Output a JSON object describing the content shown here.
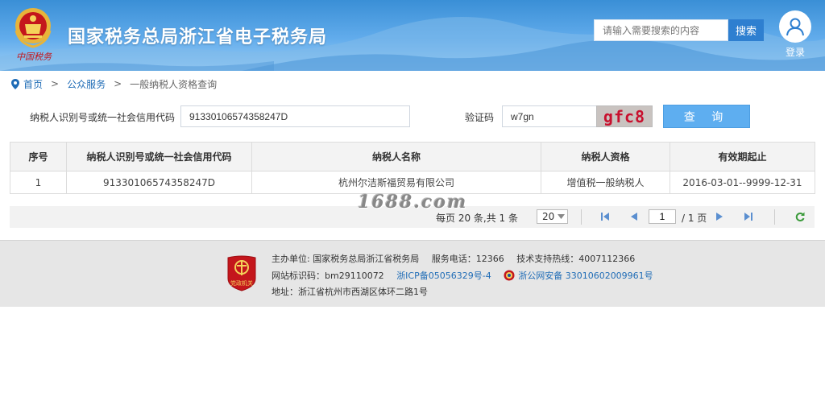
{
  "header": {
    "site_title": "国家税务总局浙江省电子税务局",
    "brand_signature": "中国税务",
    "search_placeholder": "请输入需要搜索的内容",
    "search_button": "搜索",
    "login_label": "登录"
  },
  "breadcrumb": {
    "home": "首页",
    "sep1": ">",
    "public_service": "公众服务",
    "sep2": ">",
    "current": "一般纳税人资格查询"
  },
  "query": {
    "taxpayer_id_label": "纳税人识别号或统一社会信用代码",
    "taxpayer_id_value": "91330106574358247D",
    "captcha_label": "验证码",
    "captcha_value": "w7gn",
    "captcha_image_text": "gfc8",
    "query_button": "查 询"
  },
  "results": {
    "columns": [
      "序号",
      "纳税人识别号或统一社会信用代码",
      "纳税人名称",
      "纳税人资格",
      "有效期起止"
    ],
    "rows": [
      [
        "1",
        "91330106574358247D",
        "杭州尔洁斯福贸易有限公司",
        "增值税一般纳税人",
        "2016-03-01--9999-12-31"
      ]
    ]
  },
  "watermark": "1688.com",
  "pager": {
    "summary": "每页 20 条,共 1 条",
    "page_size": "20",
    "current_page": "1",
    "total_pages": "/ 1 页"
  },
  "footer": {
    "host_label": "主办单位:",
    "host_value": "国家税务总局浙江省税务局",
    "service_phone": "服务电话：12366",
    "support_hotline": "技术支持热线：4007112366",
    "site_id": "网站标识码：bm29110072",
    "icp": "浙ICP备05056329号-4",
    "police_record": "浙公网安备 33010602009961号",
    "address": "地址：浙江省杭州市西湖区体环二路1号",
    "badge_text": "党政机关"
  },
  "colors": {
    "header_blue": "#3a8fd6",
    "link_blue": "#1f6cb6",
    "query_button": "#5eaef0",
    "brand_red": "#c4161c"
  }
}
